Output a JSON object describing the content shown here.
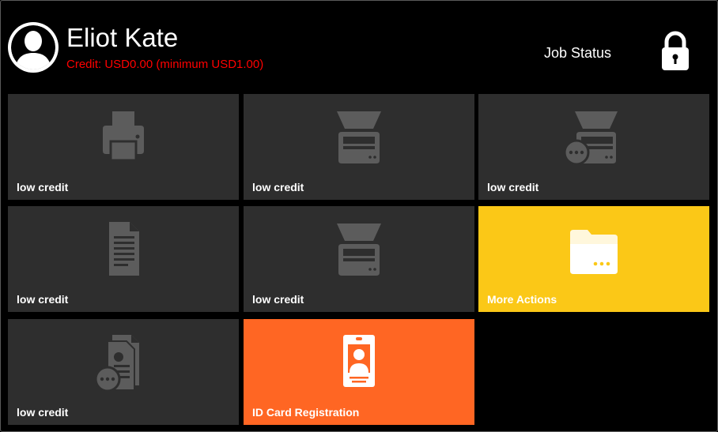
{
  "user": {
    "name": "Eliot Kate",
    "credit": "Credit: USD0.00 (minimum USD1.00)"
  },
  "header": {
    "job_status": "Job Status"
  },
  "tiles": [
    {
      "label": "low credit",
      "icon": "printer-icon"
    },
    {
      "label": "low credit",
      "icon": "scanner-icon"
    },
    {
      "label": "low credit",
      "icon": "scan-more-icon"
    },
    {
      "label": "low credit",
      "icon": "document-icon"
    },
    {
      "label": "low credit",
      "icon": "scanner-icon"
    },
    {
      "label": "More Actions",
      "icon": "folder-more-icon"
    },
    {
      "label": "low credit",
      "icon": "document-more-icon"
    },
    {
      "label": "ID Card Registration",
      "icon": "id-card-icon"
    }
  ],
  "colors": {
    "background": "#000000",
    "tile": "#2e2e2e",
    "tile_icon": "#5c5c5c",
    "more_actions": "#fbc817",
    "id_card": "#ff6623",
    "credit_text": "#ff0000"
  }
}
